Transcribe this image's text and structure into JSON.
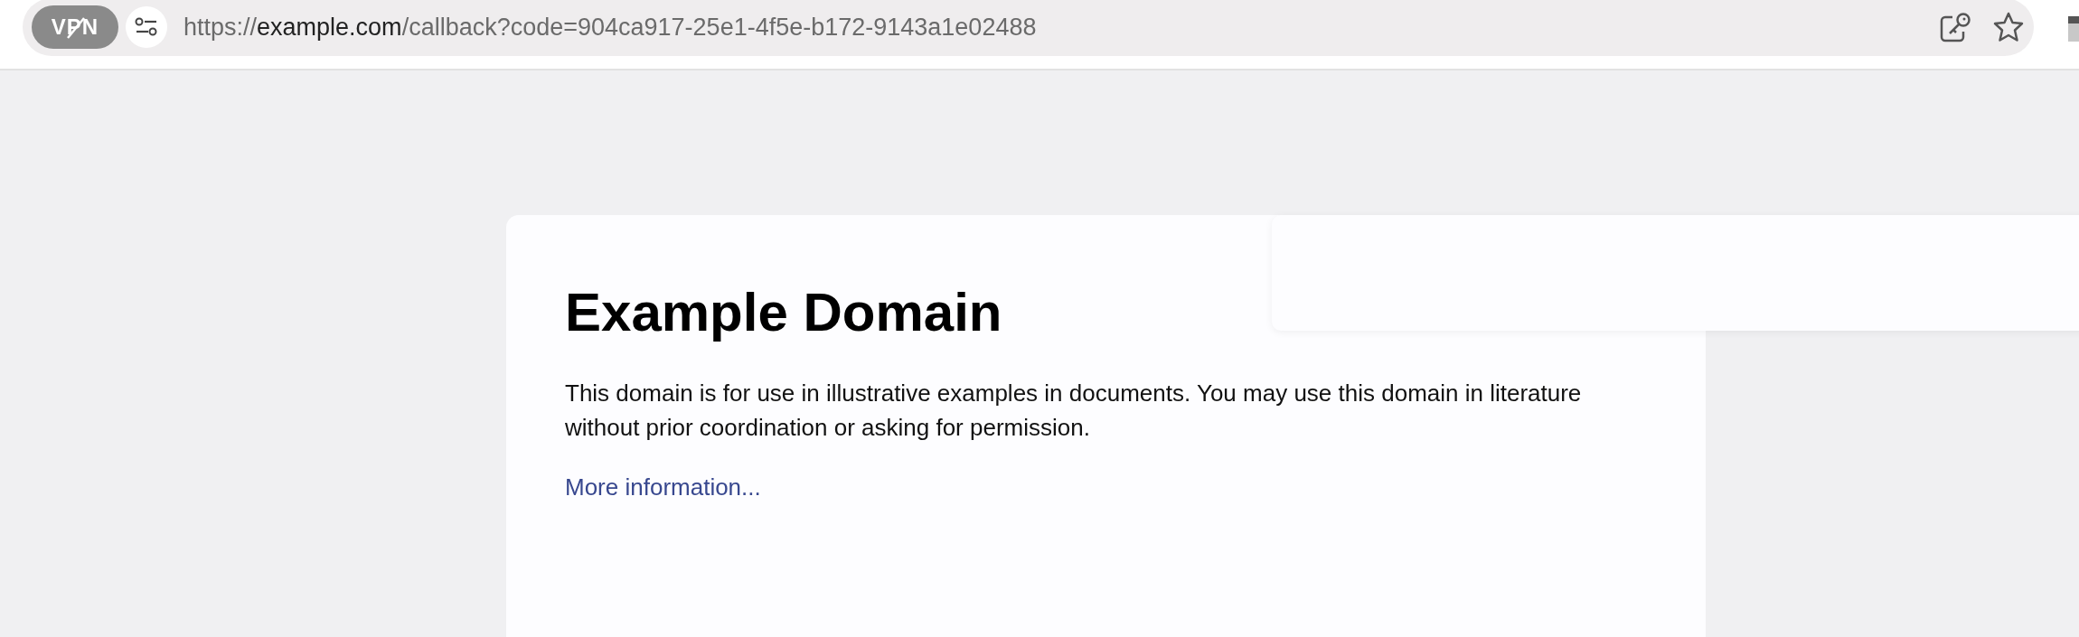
{
  "toolbar": {
    "vpn_badge": "VPN",
    "url": {
      "scheme": "https://",
      "host": "example.com",
      "path": "/callback?code=904ca917-25e1-4f5e-b172-9143a1e02488"
    }
  },
  "page": {
    "title": "Example Domain",
    "paragraph": "This domain is for use in illustrative examples in documents. You may use this domain in literature without prior coordination or asking for permission.",
    "link": "More information..."
  }
}
